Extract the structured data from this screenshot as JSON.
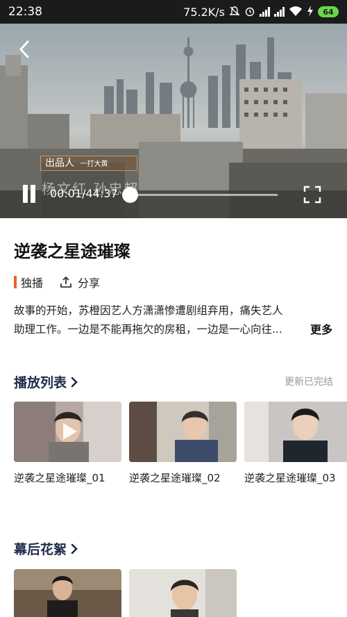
{
  "status_bar": {
    "time": "22:38",
    "net_speed": "75.2K/s",
    "battery": "64"
  },
  "video": {
    "subtitle_caption": "出品人",
    "subtitle_small": "一打大黄",
    "credit_text": "杨文红  孙忠超",
    "time_label": "00:01/44:37",
    "progress_fraction": 0.0004
  },
  "program": {
    "title": "逆袭之星途璀璨",
    "exclusive_tag": "独播",
    "share_label": "分享",
    "description_line1": "故事的开始，苏橙因艺人方潇潇惨遭剧组弃用，痛失艺人",
    "description_line2": "助理工作。一边是不能再拖欠的房租，一边是一心向往...",
    "more_label": "更多"
  },
  "playlist": {
    "heading": "播放列表",
    "status": "更新已完结",
    "items": [
      {
        "label": "逆袭之星途璀璨_01"
      },
      {
        "label": "逆袭之星途璀璨_02"
      },
      {
        "label": "逆袭之星途璀璨_03"
      }
    ]
  },
  "behind_scenes": {
    "heading": "幕后花絮"
  },
  "colors": {
    "accent": "#f25e2a",
    "heading": "#1d2b4a",
    "battery": "#6ad54b"
  }
}
